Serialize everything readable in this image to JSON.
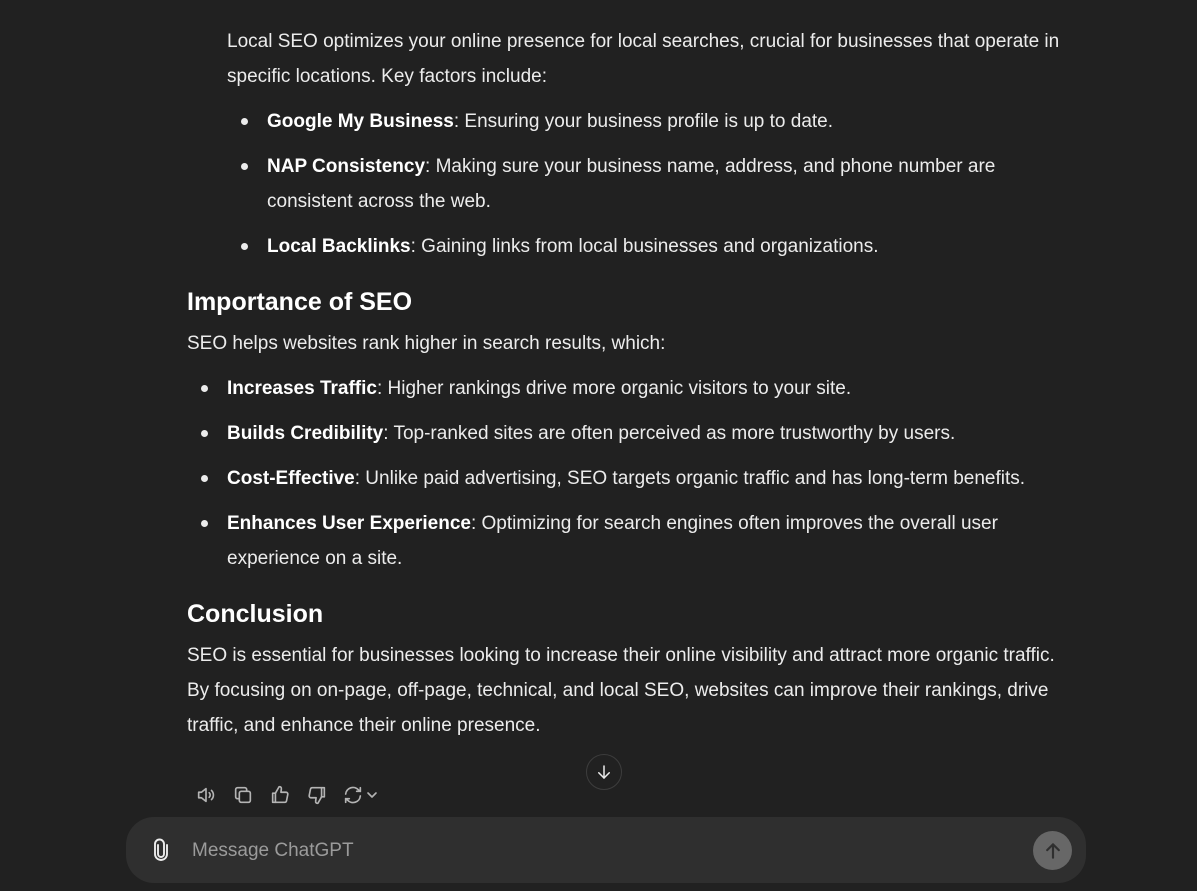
{
  "message": {
    "local_seo_intro": "Local SEO optimizes your online presence for local searches, crucial for businesses that operate in specific locations. Key factors include:",
    "local_seo_factors": [
      {
        "term": "Google My Business",
        "desc": ": Ensuring your business profile is up to date."
      },
      {
        "term": "NAP Consistency",
        "desc": ": Making sure your business name, address, and phone number are consistent across the web."
      },
      {
        "term": "Local Backlinks",
        "desc": ": Gaining links from local businesses and organizations."
      }
    ],
    "importance_heading": "Importance of SEO",
    "importance_intro": "SEO helps websites rank higher in search results, which:",
    "importance_items": [
      {
        "term": "Increases Traffic",
        "desc": ": Higher rankings drive more organic visitors to your site."
      },
      {
        "term": "Builds Credibility",
        "desc": ": Top-ranked sites are often perceived as more trustworthy by users."
      },
      {
        "term": "Cost-Effective",
        "desc": ": Unlike paid advertising, SEO targets organic traffic and has long-term benefits."
      },
      {
        "term": "Enhances User Experience",
        "desc": ": Optimizing for search engines often improves the overall user experience on a site."
      }
    ],
    "conclusion_heading": "Conclusion",
    "conclusion_text": "SEO is essential for businesses looking to increase their online visibility and attract more organic traffic. By focusing on on-page, off-page, technical, and local SEO, websites can improve their rankings, drive traffic, and enhance their online presence."
  },
  "actions": {
    "icons": [
      "read-aloud-icon",
      "copy-icon",
      "thumbs-up-icon",
      "thumbs-down-icon",
      "regenerate-icon",
      "chevron-down-icon"
    ]
  },
  "composer": {
    "placeholder": "Message ChatGPT",
    "value": ""
  },
  "colors": {
    "background": "#212121",
    "composer_bg": "#2f2f2f",
    "text": "#ececec",
    "send_button": "#676767"
  }
}
